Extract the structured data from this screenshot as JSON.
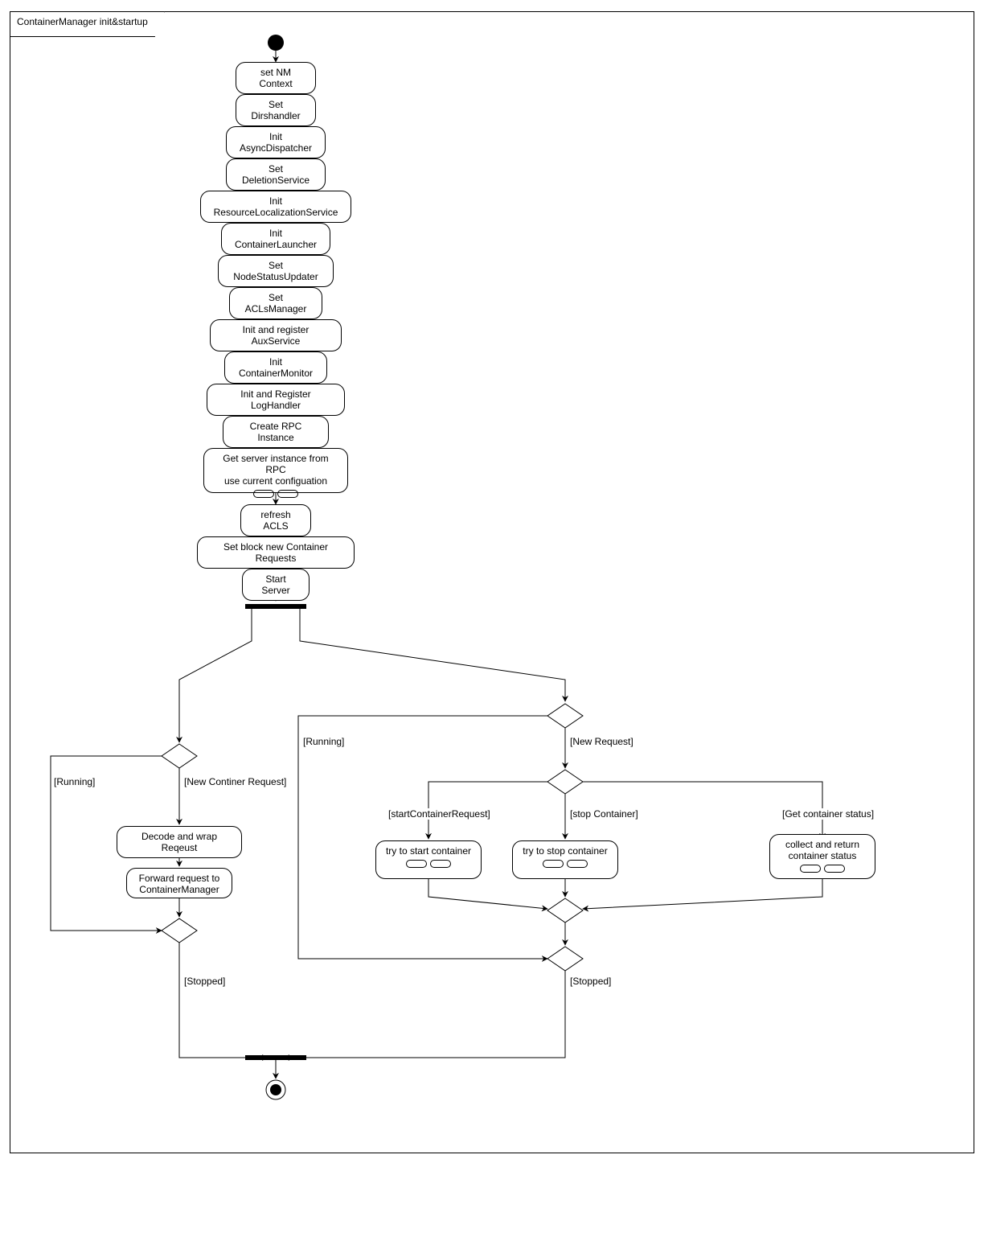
{
  "frame_title": "ContainerManager init&startup",
  "steps": {
    "s1": "set NM Context",
    "s2": "Set Dirshandler",
    "s3": "Init AsyncDispatcher",
    "s4": "Set DeletionService",
    "s5": "Init ResourceLocalizationService",
    "s6": "Init ContainerLauncher",
    "s7": "Set NodeStatusUpdater",
    "s8": "Set ACLsManager",
    "s9": "Init and register AuxService",
    "s10": "Init ContainerMonitor",
    "s11": "Init and Register LogHandler",
    "s12": "Create RPC Instance",
    "s13_line1": "Get server instance from RPC",
    "s13_line2": "use current configuation",
    "s14": "refresh ACLS",
    "s15": "Set block new Container Requests",
    "s16": "Start Server"
  },
  "left": {
    "guard_running": "[Running]",
    "guard_new": "[New Continer Request]",
    "decode": "Decode and wrap Reqeust",
    "forward_line1": "Forward request to",
    "forward_line2": "ContainerManager",
    "guard_stopped": "[Stopped]"
  },
  "right": {
    "guard_running": "[Running]",
    "guard_new": "[New Request]",
    "guard_start": "[startContainerRequest]",
    "guard_stop": "[stop Container]",
    "guard_status": "[Get container status]",
    "try_start": "try to start container",
    "try_stop": "try to stop container",
    "collect_line1": "collect and return",
    "collect_line2": "container status",
    "guard_stopped": "[Stopped]"
  },
  "chart_data": {
    "type": "uml_activity_diagram",
    "title": "ContainerManager init&startup",
    "nodes": [
      {
        "id": "initial",
        "type": "initial"
      },
      {
        "id": "s1",
        "type": "action",
        "label": "set NM Context"
      },
      {
        "id": "s2",
        "type": "action",
        "label": "Set Dirshandler"
      },
      {
        "id": "s3",
        "type": "action",
        "label": "Init AsyncDispatcher"
      },
      {
        "id": "s4",
        "type": "action",
        "label": "Set DeletionService"
      },
      {
        "id": "s5",
        "type": "action",
        "label": "Init ResourceLocalizationService"
      },
      {
        "id": "s6",
        "type": "action",
        "label": "Init ContainerLauncher"
      },
      {
        "id": "s7",
        "type": "action",
        "label": "Set NodeStatusUpdater"
      },
      {
        "id": "s8",
        "type": "action",
        "label": "Set ACLsManager"
      },
      {
        "id": "s9",
        "type": "action",
        "label": "Init and register AuxService"
      },
      {
        "id": "s10",
        "type": "action",
        "label": "Init ContainerMonitor"
      },
      {
        "id": "s11",
        "type": "action",
        "label": "Init and Register LogHandler"
      },
      {
        "id": "s12",
        "type": "action",
        "label": "Create RPC Instance"
      },
      {
        "id": "s13",
        "type": "action",
        "label": "Get server instance from RPC use current configuation",
        "subactivity": true
      },
      {
        "id": "s14",
        "type": "action",
        "label": "refresh ACLS"
      },
      {
        "id": "s15",
        "type": "action",
        "label": "Set block new Container Requests"
      },
      {
        "id": "s16",
        "type": "action",
        "label": "Start Server"
      },
      {
        "id": "fork",
        "type": "fork"
      },
      {
        "id": "dL1",
        "type": "decision"
      },
      {
        "id": "decode",
        "type": "action",
        "label": "Decode and wrap Reqeust"
      },
      {
        "id": "forward",
        "type": "action",
        "label": "Forward request to ContainerManager"
      },
      {
        "id": "dL2",
        "type": "decision"
      },
      {
        "id": "dR1",
        "type": "decision"
      },
      {
        "id": "dR2",
        "type": "decision"
      },
      {
        "id": "try_start",
        "type": "action",
        "label": "try to start container",
        "subactivity": true
      },
      {
        "id": "try_stop",
        "type": "action",
        "label": "try to stop container",
        "subactivity": true
      },
      {
        "id": "collect",
        "type": "action",
        "label": "collect and return container status",
        "subactivity": true
      },
      {
        "id": "mR",
        "type": "merge"
      },
      {
        "id": "dR3",
        "type": "decision"
      },
      {
        "id": "join",
        "type": "join"
      },
      {
        "id": "final",
        "type": "final"
      }
    ],
    "edges": [
      {
        "from": "initial",
        "to": "s1"
      },
      {
        "from": "s1",
        "to": "s2"
      },
      {
        "from": "s2",
        "to": "s3"
      },
      {
        "from": "s3",
        "to": "s4"
      },
      {
        "from": "s4",
        "to": "s5"
      },
      {
        "from": "s5",
        "to": "s6"
      },
      {
        "from": "s6",
        "to": "s7"
      },
      {
        "from": "s7",
        "to": "s8"
      },
      {
        "from": "s8",
        "to": "s9"
      },
      {
        "from": "s9",
        "to": "s10"
      },
      {
        "from": "s10",
        "to": "s11"
      },
      {
        "from": "s11",
        "to": "s12"
      },
      {
        "from": "s12",
        "to": "s13"
      },
      {
        "from": "s13",
        "to": "s14"
      },
      {
        "from": "s14",
        "to": "s15"
      },
      {
        "from": "s15",
        "to": "s16"
      },
      {
        "from": "s16",
        "to": "fork"
      },
      {
        "from": "fork",
        "to": "dL1"
      },
      {
        "from": "fork",
        "to": "dR1"
      },
      {
        "from": "dL1",
        "to": "decode",
        "guard": "New Continer Request"
      },
      {
        "from": "dL1",
        "to": "dL2",
        "guard": "Running",
        "note": "loop-back path"
      },
      {
        "from": "decode",
        "to": "forward"
      },
      {
        "from": "forward",
        "to": "dL2"
      },
      {
        "from": "dL2",
        "to": "dL1",
        "note": "loop up on left side"
      },
      {
        "from": "dL2",
        "to": "join",
        "guard": "Stopped"
      },
      {
        "from": "dR1",
        "to": "dR2",
        "guard": "New Request"
      },
      {
        "from": "dR1",
        "to": "dR3",
        "guard": "Running",
        "note": "loop path"
      },
      {
        "from": "dR2",
        "to": "try_start",
        "guard": "startContainerRequest"
      },
      {
        "from": "dR2",
        "to": "try_stop",
        "guard": "stop Container"
      },
      {
        "from": "dR2",
        "to": "collect",
        "guard": "Get container status"
      },
      {
        "from": "try_start",
        "to": "mR"
      },
      {
        "from": "try_stop",
        "to": "mR"
      },
      {
        "from": "collect",
        "to": "mR"
      },
      {
        "from": "mR",
        "to": "dR3"
      },
      {
        "from": "dR3",
        "to": "dR1",
        "note": "loop back up"
      },
      {
        "from": "dR3",
        "to": "join",
        "guard": "Stopped"
      },
      {
        "from": "join",
        "to": "final"
      }
    ]
  }
}
